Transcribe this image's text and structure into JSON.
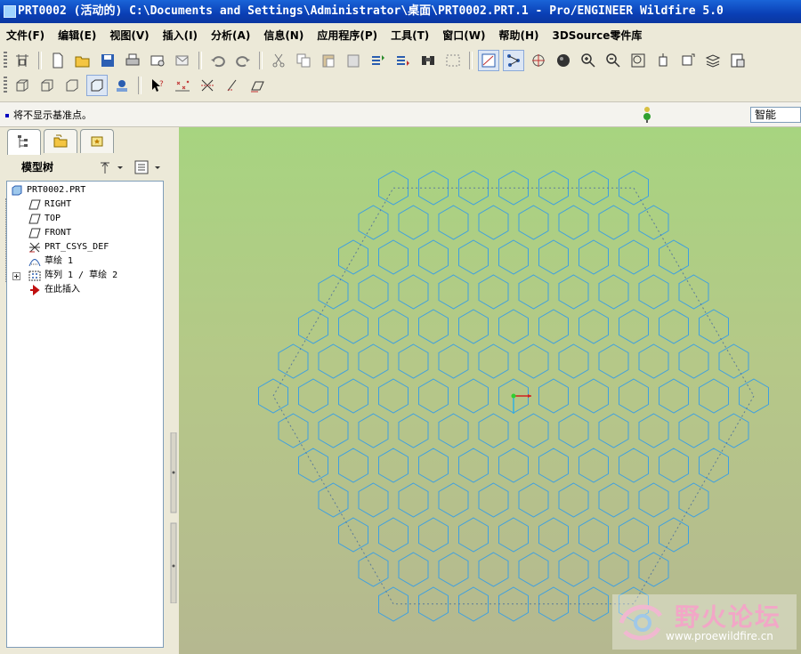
{
  "window": {
    "title": "PRT0002 (活动的) C:\\Documents and Settings\\Administrator\\桌面\\PRT0002.PRT.1 - Pro/ENGINEER Wildfire 5.0"
  },
  "menu": [
    {
      "label": "文件(F)"
    },
    {
      "label": "编辑(E)"
    },
    {
      "label": "视图(V)"
    },
    {
      "label": "插入(I)"
    },
    {
      "label": "分析(A)"
    },
    {
      "label": "信息(N)"
    },
    {
      "label": "应用程序(P)"
    },
    {
      "label": "工具(T)"
    },
    {
      "label": "窗口(W)"
    },
    {
      "label": "帮助(H)"
    },
    {
      "label": "3DSource零件库"
    }
  ],
  "message_bar": {
    "text": "将不显示基准点。"
  },
  "filter": {
    "value": "智能"
  },
  "model_tree": {
    "title": "模型树",
    "items": [
      {
        "label": "PRT0002.PRT",
        "icon": "part-icon"
      },
      {
        "label": "RIGHT",
        "icon": "datum-plane-icon"
      },
      {
        "label": "TOP",
        "icon": "datum-plane-icon"
      },
      {
        "label": "FRONT",
        "icon": "datum-plane-icon"
      },
      {
        "label": "PRT_CSYS_DEF",
        "icon": "csys-icon"
      },
      {
        "label": "草绘 1",
        "icon": "sketch-icon"
      },
      {
        "label": "阵列 1 / 草绘 2",
        "icon": "pattern-icon"
      },
      {
        "label": "在此插入",
        "icon": "insert-arrow-icon"
      }
    ]
  },
  "toolbar": {
    "row1_icons": [
      "sketch-setup-icon",
      "new-file-icon",
      "open-folder-icon",
      "save-icon",
      "print-icon",
      "email-icon",
      "email-link-icon",
      "undo-icon",
      "redo-icon",
      "cut-icon",
      "copy-icon",
      "paste-icon",
      "paste-special-icon",
      "regenerate-icon",
      "regen-manager-icon",
      "find-icon",
      "select-box-icon",
      "datum-display-icon",
      "network-icon",
      "spin-center-icon",
      "shade-icon",
      "zoom-in-icon",
      "zoom-out-icon",
      "refit-icon",
      "orient-icon",
      "saved-views-icon",
      "layers-icon",
      "view-manager-icon"
    ],
    "row2_icons": [
      "wireframe-icon",
      "hidden-line-icon",
      "no-hidden-icon",
      "shaded-icon",
      "enhanced-realism-icon",
      "whats-this-icon",
      "datum-planes-toggle-icon",
      "datum-axes-toggle-icon",
      "datum-points-toggle-icon",
      "csys-toggle-icon"
    ]
  },
  "viewport": {
    "background_top": "#a7d480",
    "background_bottom": "#b5b890",
    "sketch_color": "#3ea0e0",
    "construction_color": "#5a7a9a"
  },
  "watermark": {
    "title": "野火论坛",
    "url": "www.proewildfire.cn"
  }
}
